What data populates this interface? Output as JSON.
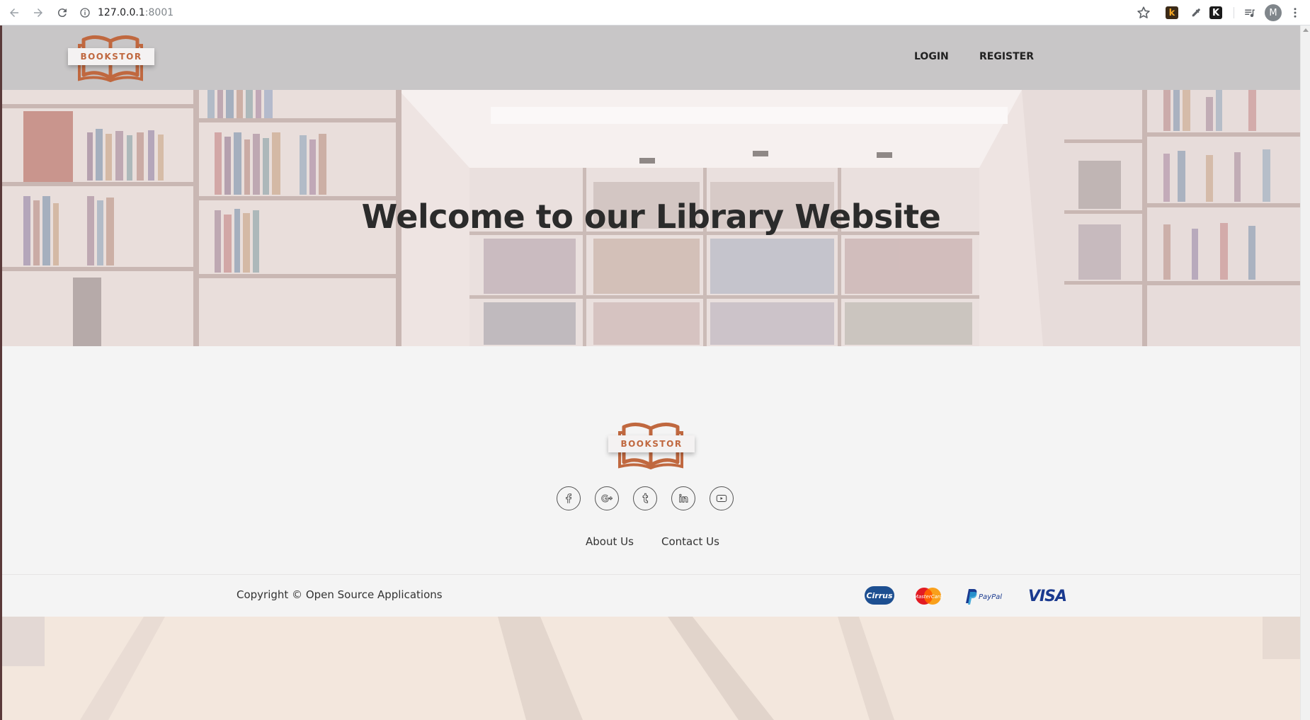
{
  "browser": {
    "url_host": "127.0.0.1",
    "url_port": ":8001",
    "profile_initial": "M",
    "extensions": [
      "k",
      "K"
    ]
  },
  "header": {
    "logo_text": "BOOKSTOR",
    "nav": [
      "LOGIN",
      "REGISTER"
    ]
  },
  "hero": {
    "title": "Welcome to our Library Website"
  },
  "footer": {
    "logo_text": "BOOKSTOR",
    "social": [
      "facebook-icon",
      "google-plus-icon",
      "tumblr-icon",
      "linkedin-icon",
      "youtube-icon"
    ],
    "links": [
      "About Us",
      "Contact Us"
    ],
    "copyright": "Copyright © Open Source Applications",
    "payments": {
      "cirrus": "Cirrus",
      "mastercard": "MasterCard",
      "paypal": "PayPal",
      "visa": "VISA"
    }
  },
  "colors": {
    "brand": "#c0683f",
    "header_bg": "#c8c6c7",
    "footer_bg": "#f4f4f4"
  }
}
